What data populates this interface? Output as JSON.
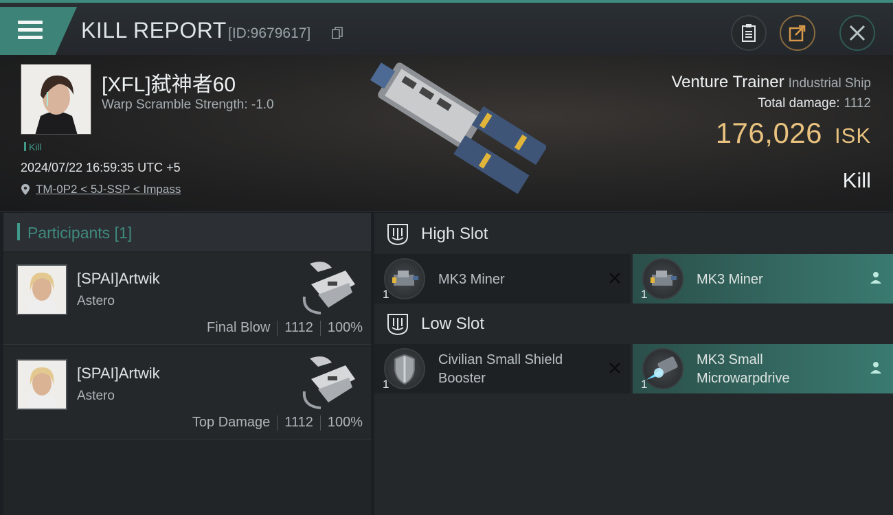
{
  "header": {
    "title": "KILL REPORT",
    "report_id": "[ID:9679617]"
  },
  "victim": {
    "pilot_name": "[XFL]弑神者60",
    "warp_scramble": "Warp Scramble Strength: -1.0",
    "kill_tag": "Kill",
    "datetime": "2024/07/22 16:59:35 UTC +5",
    "location": "TM-0P2 < 5J-SSP < Impass",
    "ship_name": "Venture Trainer",
    "ship_class": "Industrial Ship",
    "total_damage_label": "Total damage:",
    "total_damage_value": "1112",
    "isk_value": "176,026",
    "isk_unit": "ISK",
    "result": "Kill"
  },
  "participants": {
    "label": "Participants [1]",
    "rows": [
      {
        "name": "[SPAI]Artwik",
        "ship": "Astero",
        "role": "Final Blow",
        "damage": "1112",
        "percent": "100%"
      },
      {
        "name": "[SPAI]Artwik",
        "ship": "Astero",
        "role": "Top Damage",
        "damage": "1112",
        "percent": "100%"
      }
    ]
  },
  "slots": {
    "high": {
      "label": "High Slot",
      "modules": [
        {
          "name": "MK3 Miner",
          "qty": "1",
          "status": "destroyed"
        },
        {
          "name": "MK3 Miner",
          "qty": "1",
          "status": "dropped"
        }
      ]
    },
    "low": {
      "label": "Low Slot",
      "modules": [
        {
          "name_line1": "Civilian Small Shield",
          "name_line2": "Booster",
          "qty": "1",
          "status": "destroyed"
        },
        {
          "name_line1": "MK3 Small",
          "name_line2": "Microwarpdrive",
          "qty": "1",
          "status": "dropped"
        }
      ]
    }
  },
  "colors": {
    "accent_teal": "#3f8a7e",
    "isk_gold": "#e8c27e",
    "share_orange": "#d89a4a"
  },
  "icons": [
    "menu-icon",
    "copy-icon",
    "clipboard-icon",
    "share-icon",
    "close-icon",
    "location-pin-icon",
    "high-slot-icon",
    "low-slot-icon",
    "destroyed-x-icon",
    "person-icon"
  ]
}
